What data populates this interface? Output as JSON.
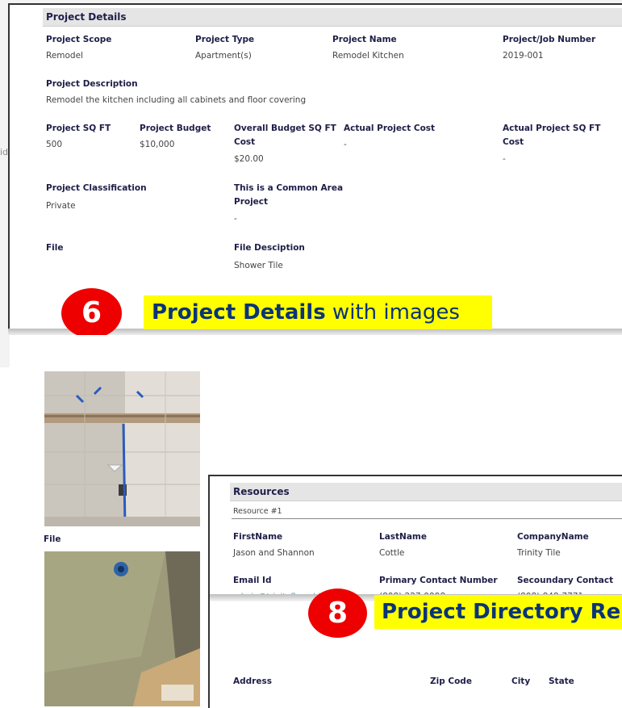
{
  "background": {
    "stub_text": "id"
  },
  "project_details": {
    "title": "Project Details",
    "scope_label": "Project Scope",
    "scope_value": "Remodel",
    "type_label": "Project Type",
    "type_value": "Apartment(s)",
    "name_label": "Project Name",
    "name_value": "Remodel Kitchen",
    "number_label": "Project/Job Number",
    "number_value": "2019-001",
    "description_label": "Project Description",
    "description_value": "Remodel the kitchen including all cabinets and floor covering",
    "sqft_label": "Project SQ FT",
    "sqft_value": "500",
    "budget_label": "Project Budget",
    "budget_value": "$10,000",
    "overall_label_1": "Overall Budget SQ FT",
    "overall_label_2": "Cost",
    "overall_value": "$20.00",
    "actual_cost_label": "Actual Project Cost",
    "actual_cost_value": "-",
    "actual_sqft_label_1": "Actual Project SQ FT",
    "actual_sqft_label_2": "Cost",
    "actual_sqft_value": "-",
    "classification_label": "Project Classification",
    "classification_value": "Private",
    "common_area_label_1": "This is a Common Area",
    "common_area_label_2": "Project",
    "common_area_value": "-",
    "file_label": "File",
    "file_description_label": "File Desciption",
    "file_description_value": "Shower Tile"
  },
  "callout_6": {
    "number": "6",
    "bold": "Project Details",
    "rest": " with images"
  },
  "images_pane": {
    "file_label": "File"
  },
  "resources": {
    "title": "Resources",
    "subtitle": "Resource #1",
    "firstname_label": "FirstName",
    "firstname_value": "Jason and Shannon",
    "lastname_label": "LastName",
    "lastname_value": "Cottle",
    "company_label": "CompanyName",
    "company_value": "Trinity Tile",
    "email_label": "Email Id",
    "email_value": "admin@trinityfloorshi.com",
    "primary_label": "Primary Contact Number",
    "primary_value": "(808) 227-9998",
    "secondary_label": "Secoundary Contact",
    "secondary_value": "(808) 848-7771",
    "address_label": "Address",
    "zip_label": "Zip Code",
    "city_label": "City",
    "state_label": "State"
  },
  "callout_8": {
    "number": "8",
    "text": "Project Directory Re"
  },
  "colors": {
    "badge": "#ee0000",
    "callout_bg": "#ffff00",
    "callout_text": "#0a3478",
    "link": "#2a9fd8"
  }
}
